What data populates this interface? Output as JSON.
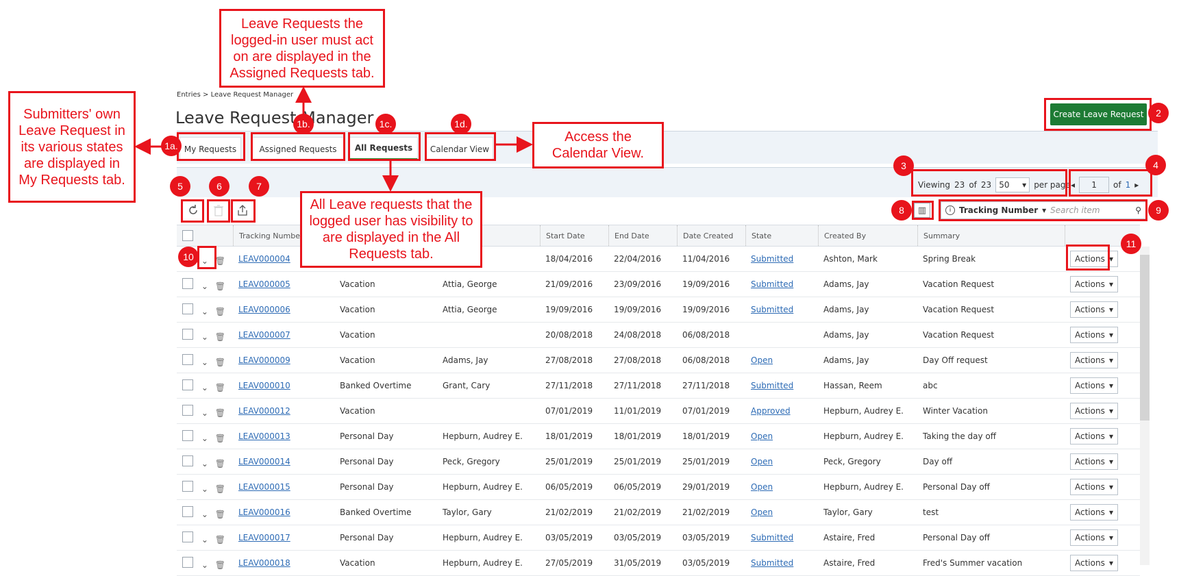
{
  "breadcrumb": "Entries > Leave Request Manager",
  "page_title": "Leave Request Manager",
  "create_button": "Create Leave Request",
  "tabs": [
    {
      "label": "My Requests"
    },
    {
      "label": "Assigned Requests"
    },
    {
      "label": "All Requests"
    },
    {
      "label": "Calendar View"
    }
  ],
  "pagination": {
    "viewing": "Viewing",
    "count": "23",
    "of_text": "of",
    "total": "23",
    "per_page_value": "50",
    "per_page_label": "per page",
    "page_value": "1",
    "page_of": "of",
    "page_total": "1"
  },
  "search": {
    "field": "Tracking Number",
    "placeholder": "Search item"
  },
  "columns": [
    "Tracking Number",
    "",
    "",
    "Start Date",
    "End Date",
    "Date Created",
    "State",
    "Created By",
    "Summary"
  ],
  "rows": [
    {
      "id": "LEAV000004",
      "type": "",
      "assigned": "",
      "start": "18/04/2016",
      "end": "22/04/2016",
      "created": "11/04/2016",
      "state": "Submitted",
      "by": "Ashton, Mark",
      "summary": "Spring Break"
    },
    {
      "id": "LEAV000005",
      "type": "Vacation",
      "assigned": "Attia, George",
      "start": "21/09/2016",
      "end": "23/09/2016",
      "created": "19/09/2016",
      "state": "Submitted",
      "by": "Adams, Jay",
      "summary": "Vacation Request"
    },
    {
      "id": "LEAV000006",
      "type": "Vacation",
      "assigned": "Attia, George",
      "start": "19/09/2016",
      "end": "19/09/2016",
      "created": "19/09/2016",
      "state": "Submitted",
      "by": "Adams, Jay",
      "summary": "Vacation Request"
    },
    {
      "id": "LEAV000007",
      "type": "Vacation",
      "assigned": "",
      "start": "20/08/2018",
      "end": "24/08/2018",
      "created": "06/08/2018",
      "state": "",
      "by": "Adams, Jay",
      "summary": "Vacation Request"
    },
    {
      "id": "LEAV000009",
      "type": "Vacation",
      "assigned": "Adams, Jay",
      "start": "27/08/2018",
      "end": "27/08/2018",
      "created": "06/08/2018",
      "state": "Open",
      "by": "Adams, Jay",
      "summary": "Day Off request"
    },
    {
      "id": "LEAV000010",
      "type": "Banked Overtime",
      "assigned": "Grant, Cary",
      "start": "27/11/2018",
      "end": "27/11/2018",
      "created": "27/11/2018",
      "state": "Submitted",
      "by": "Hassan, Reem",
      "summary": "abc"
    },
    {
      "id": "LEAV000012",
      "type": "Vacation",
      "assigned": "",
      "start": "07/01/2019",
      "end": "11/01/2019",
      "created": "07/01/2019",
      "state": "Approved",
      "by": "Hepburn, Audrey E.",
      "summary": "Winter Vacation"
    },
    {
      "id": "LEAV000013",
      "type": "Personal Day",
      "assigned": "Hepburn, Audrey E.",
      "start": "18/01/2019",
      "end": "18/01/2019",
      "created": "18/01/2019",
      "state": "Open",
      "by": "Hepburn, Audrey E.",
      "summary": "Taking the day off"
    },
    {
      "id": "LEAV000014",
      "type": "Personal Day",
      "assigned": "Peck, Gregory",
      "start": "25/01/2019",
      "end": "25/01/2019",
      "created": "25/01/2019",
      "state": "Open",
      "by": "Peck, Gregory",
      "summary": "Day off"
    },
    {
      "id": "LEAV000015",
      "type": "Personal Day",
      "assigned": "Hepburn, Audrey E.",
      "start": "06/05/2019",
      "end": "06/05/2019",
      "created": "29/01/2019",
      "state": "Open",
      "by": "Hepburn, Audrey E.",
      "summary": "Personal Day off"
    },
    {
      "id": "LEAV000016",
      "type": "Banked Overtime",
      "assigned": "Taylor, Gary",
      "start": "21/02/2019",
      "end": "21/02/2019",
      "created": "21/02/2019",
      "state": "Open",
      "by": "Taylor, Gary",
      "summary": "test"
    },
    {
      "id": "LEAV000017",
      "type": "Personal Day",
      "assigned": "Hepburn, Audrey E.",
      "start": "03/05/2019",
      "end": "03/05/2019",
      "created": "03/05/2019",
      "state": "Submitted",
      "by": "Astaire, Fred",
      "summary": "Personal Day off"
    },
    {
      "id": "LEAV000018",
      "type": "Vacation",
      "assigned": "Hepburn, Audrey E.",
      "start": "27/05/2019",
      "end": "31/05/2019",
      "created": "03/05/2019",
      "state": "Submitted",
      "by": "Astaire, Fred",
      "summary": "Fred's Summer vacation"
    }
  ],
  "row_action_label": "Actions",
  "annotations": {
    "c1a": "Submitters' own Leave Request in its various states are displayed in My Requests tab.",
    "c1b": "Leave Requests the logged-in user must act on are displayed in the Assigned Requests tab.",
    "c1c": "All Leave requests that the logged user has visibility to are displayed in the All Requests tab.",
    "c1d": "Access the Calendar View.",
    "badges": [
      "1a.",
      "1b.",
      "1c.",
      "1d.",
      "2",
      "3",
      "4",
      "5",
      "6",
      "7",
      "8",
      "9",
      "10",
      "11"
    ]
  },
  "colors": {
    "accent_green": "#1d7b34",
    "link_blue": "#2d6bb5",
    "annotation_red": "#e8141c"
  }
}
